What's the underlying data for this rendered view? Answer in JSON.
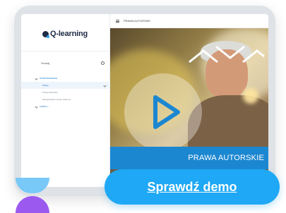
{
  "app": {
    "logo_text": "Q-learning",
    "brand_colors": {
      "primary": "#1ea8f5",
      "accent": "#9b59f0",
      "banner": "#1c87d1"
    }
  },
  "topbar": {
    "breadcrumb": "PRAWA AUTORSKIE"
  },
  "sidebar": {
    "search_placeholder": "Szukaj",
    "items": [
      {
        "label": "WPROWADZENIE",
        "type": "section",
        "expanded": true
      },
      {
        "label": "Wstęp",
        "type": "lesson",
        "active": true
      },
      {
        "label": "Prawa autorskie",
        "type": "lesson"
      },
      {
        "label": "Akceptowalne użycie utworów",
        "type": "lesson"
      },
      {
        "label": "CZĘŚĆ 1",
        "type": "section",
        "expanded": false
      }
    ]
  },
  "video": {
    "banner_text": "PRAWA AUTORSKIE",
    "play_icon": "play-icon"
  },
  "cta": {
    "label": "Sprawdź demo"
  }
}
